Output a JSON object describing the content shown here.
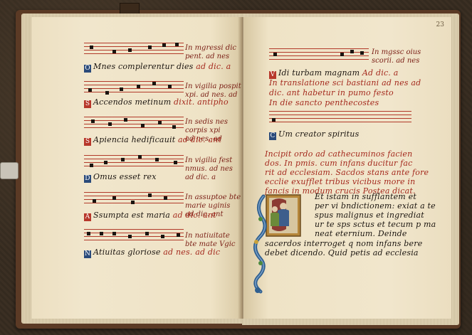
{
  "folio_number": "23",
  "left_page": {
    "entries": [
      {
        "initial": "O",
        "text": "Mnes complerentur dies",
        "cue": "ad dic. a",
        "margin": [
          "In mgressi dic",
          "pent. ad nes"
        ]
      },
      {
        "initial": "S",
        "text": "Accendos metinum",
        "cue": "dixit. antipho",
        "margin": [
          "In vigilia pospit",
          "xpi. ad nes. ad"
        ]
      },
      {
        "initial": "S",
        "text": "Apiencia hedificauit",
        "cue": "ad dic. ant",
        "margin": [
          "In sedis nes",
          "corpis xpi",
          "ad nes. ad"
        ]
      },
      {
        "initial": "D",
        "text": "Omus esset rex",
        "cue": "",
        "margin": [
          "In vigilia fest",
          "nmus. ad nes",
          "ad dic. a"
        ]
      },
      {
        "initial": "A",
        "text": "Ssumpta est maria",
        "cue": "ad dic. ant",
        "margin": [
          "In assuptoe bte",
          "marie uginis",
          "ad dic. ant"
        ]
      },
      {
        "initial": "N",
        "text": "Atiuitas gloriose",
        "cue": "ad nes. ad dic",
        "margin": [
          "In natiuitate",
          "bte mate Vgic"
        ]
      }
    ]
  },
  "right_page": {
    "top_margin": [
      "In mgssc oius",
      "scorii. ad nes"
    ],
    "lines": [
      {
        "initial": "V",
        "text": "Idi turbam magnam",
        "cue": "Ad dic. a"
      },
      {
        "initial": "",
        "text": "In translatione sci bastiani",
        "cue": "ad nes ad"
      },
      {
        "initial": "",
        "text": "dic. ant habetur in pumo festo",
        "cue": ""
      },
      {
        "initial": "",
        "text": "In die sancto penthecostes",
        "cue": ""
      },
      {
        "initial": "C",
        "text": "Um creator spiritus",
        "cue": ""
      }
    ],
    "ordo": [
      "Incipit ordo ad cathecuminos facien",
      "dos. In pmis. cum infans ducitur fac",
      "rit ad ecclesiam. Sacdos stans ante fore",
      "ecclie exufflet tribus vicibus more in",
      "fancis in modum crucis Postea dicat."
    ],
    "illum_text": [
      "Et istam in sufflantem et",
      "per vi bndictionem: exiat a te",
      "spus malignus et ingrediat",
      "ur te sps sctus et tecum p ma",
      "neat eternium. Deinde",
      "sacerdos interroget q nom infans bere",
      "debet dicendo. Quid petis ad ecclesia"
    ]
  },
  "colors": {
    "ink": "#1b1510",
    "rubric": "#a4291d",
    "parchment": "#f1e6cc"
  }
}
